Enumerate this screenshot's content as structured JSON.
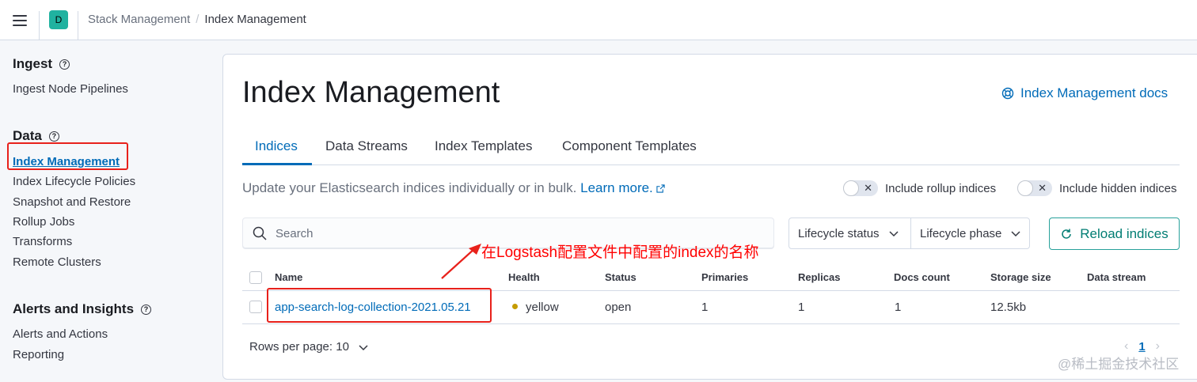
{
  "header": {
    "space_initial": "D",
    "breadcrumbs": [
      "Stack Management",
      "Index Management"
    ]
  },
  "sidebar": {
    "groups": [
      {
        "title": "Ingest",
        "items": [
          "Ingest Node Pipelines"
        ]
      },
      {
        "title": "Data",
        "items": [
          "Index Management",
          "Index Lifecycle Policies",
          "Snapshot and Restore",
          "Rollup Jobs",
          "Transforms",
          "Remote Clusters"
        ]
      },
      {
        "title": "Alerts and Insights",
        "items": [
          "Alerts and Actions",
          "Reporting"
        ]
      }
    ],
    "active_item": "Index Management"
  },
  "main": {
    "title": "Index Management",
    "docs_link": "Index Management docs",
    "tabs": [
      "Indices",
      "Data Streams",
      "Index Templates",
      "Component Templates"
    ],
    "active_tab": "Indices",
    "description": "Update your Elasticsearch indices individually or in bulk.",
    "learn_more": "Learn more.",
    "toggles": {
      "rollup": "Include rollup indices",
      "hidden": "Include hidden indices"
    },
    "search": {
      "placeholder": "Search"
    },
    "filters": {
      "lifecycle_status": "Lifecycle status",
      "lifecycle_phase": "Lifecycle phase"
    },
    "reload_button": "Reload indices",
    "annotation": "在Logstash配置文件中配置的index的名称",
    "table": {
      "columns": [
        "Name",
        "Health",
        "Status",
        "Primaries",
        "Replicas",
        "Docs count",
        "Storage size",
        "Data stream"
      ],
      "rows": [
        {
          "name": "app-search-log-collection-2021.05.21",
          "health": "yellow",
          "status": "open",
          "primaries": "1",
          "replicas": "1",
          "docs_count": "1",
          "storage_size": "12.5kb",
          "data_stream": ""
        }
      ]
    },
    "rows_per_page": "Rows per page: 10",
    "pagination": {
      "current_page": "1"
    }
  },
  "watermark": "@稀土掘金技术社区",
  "colors": {
    "accent": "#006bb8",
    "health_yellow": "#c59c00",
    "annotation_red": "#e8211b",
    "success": "#017d73"
  }
}
